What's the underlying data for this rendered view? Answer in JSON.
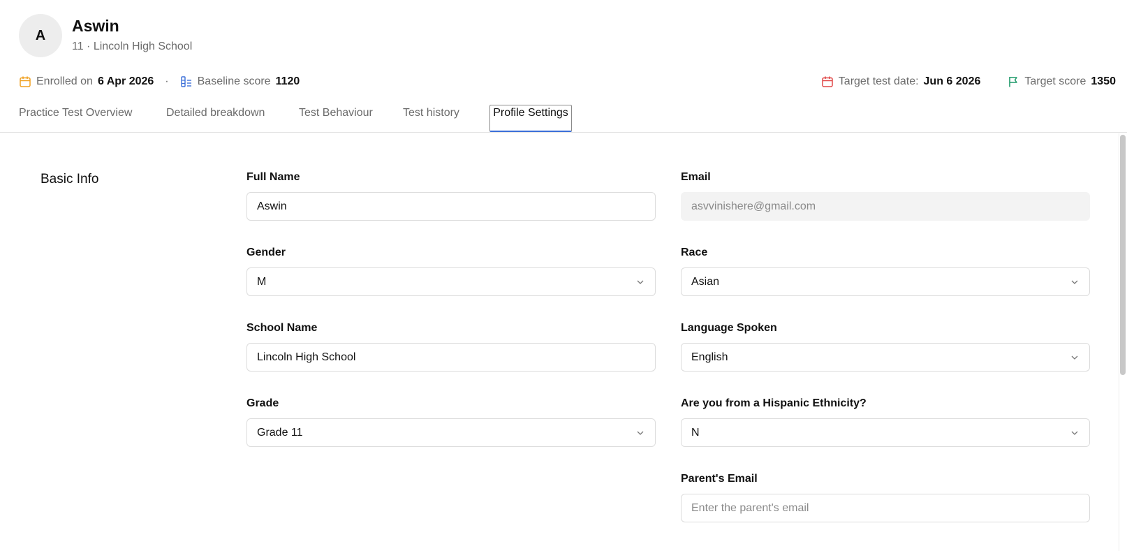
{
  "student": {
    "avatar_initial": "A",
    "name": "Aswin",
    "subtitle": "11 · Lincoln High School"
  },
  "meta": {
    "enrolled_label": "Enrolled on",
    "enrolled_value": "6 Apr 2026",
    "separator": "·",
    "baseline_label": "Baseline score",
    "baseline_value": "1120",
    "target_date_label": "Target test date:",
    "target_date_value": "Jun 6 2026",
    "target_score_label": "Target score",
    "target_score_value": "1350"
  },
  "tabs": [
    {
      "label": "Practice Test Overview",
      "active": false
    },
    {
      "label": "Detailed breakdown",
      "active": false
    },
    {
      "label": "Test Behaviour",
      "active": false
    },
    {
      "label": "Test history",
      "active": false
    },
    {
      "label": "Profile Settings",
      "active": true
    }
  ],
  "section": {
    "title": "Basic Info"
  },
  "fields": {
    "full_name": {
      "label": "Full Name",
      "value": "Aswin"
    },
    "email": {
      "label": "Email",
      "value": "asvvinishere@gmail.com"
    },
    "gender": {
      "label": "Gender",
      "value": "M"
    },
    "race": {
      "label": "Race",
      "value": "Asian"
    },
    "school_name": {
      "label": "School Name",
      "value": "Lincoln High School"
    },
    "language": {
      "label": "Language Spoken",
      "value": "English"
    },
    "grade": {
      "label": "Grade",
      "value": "Grade 11"
    },
    "hispanic": {
      "label": "Are you from a Hispanic Ethnicity?",
      "value": "N"
    },
    "parent_email": {
      "label": "Parent's Email",
      "value": "",
      "placeholder": "Enter the parent's email"
    }
  },
  "colors": {
    "calendar_icon": "#f0a020",
    "baseline_icon": "#3b6fd8",
    "target_date_icon": "#e04848",
    "target_flag_icon": "#1f9a6a",
    "active_tab_underline": "#3b6fd8"
  },
  "icons": {
    "enrolled": "calendar-icon",
    "baseline": "bar-chart-icon",
    "target_date": "calendar-icon",
    "target_score": "flag-icon",
    "select": "chevron-down-icon"
  }
}
